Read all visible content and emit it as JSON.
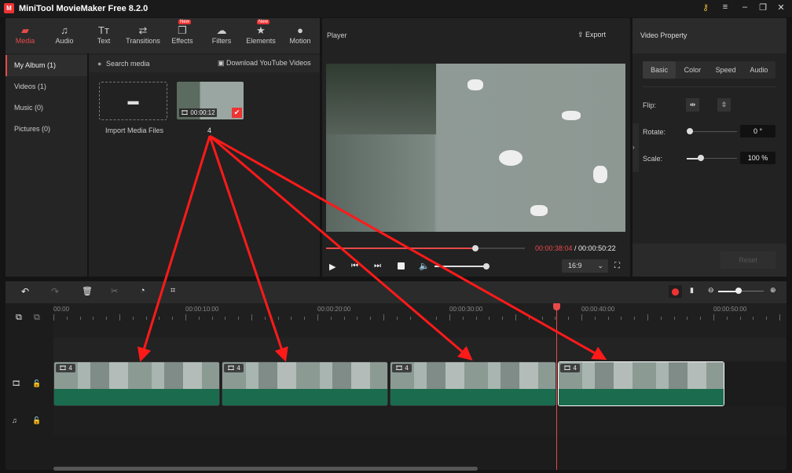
{
  "app": {
    "title": "MiniTool MovieMaker Free 8.2.0"
  },
  "toolbar": [
    {
      "label": "Media",
      "icon": "folder-icon",
      "active": true
    },
    {
      "label": "Audio",
      "icon": "music-icon"
    },
    {
      "label": "Text",
      "icon": "text-icon"
    },
    {
      "label": "Transitions",
      "icon": "transitions-icon"
    },
    {
      "label": "Effects",
      "icon": "effects-icon",
      "badge": "New"
    },
    {
      "label": "Filters",
      "icon": "filters-icon"
    },
    {
      "label": "Elements",
      "icon": "elements-icon",
      "badge": "New"
    },
    {
      "label": "Motion",
      "icon": "motion-icon"
    }
  ],
  "sidebar": {
    "items": [
      {
        "label": "My Album (1)"
      },
      {
        "label": "Videos (1)"
      },
      {
        "label": "Music (0)"
      },
      {
        "label": "Pictures (0)"
      }
    ]
  },
  "media": {
    "search_placeholder": "Search media",
    "download": "Download YouTube Videos",
    "import_label": "Import Media Files",
    "clip_duration": "00:00:12",
    "clip_count": "4"
  },
  "player": {
    "title": "Player",
    "export": "Export",
    "current_time": "00:00:38:04",
    "total_time": " / 00:00:50:22",
    "progress": 0.75,
    "volume": 0.8,
    "aspect": "16:9"
  },
  "property": {
    "title": "Video Property",
    "tabs": [
      "Basic",
      "Color",
      "Speed",
      "Audio"
    ],
    "flip_label": "Flip:",
    "rotate_label": "Rotate:",
    "rotate_value": "0 °",
    "scale_label": "Scale:",
    "scale_value": "100 %",
    "reset": "Reset"
  },
  "timeline": {
    "ruler": [
      "00:00",
      "00:00:10:00",
      "00:00:20:00",
      "00:00:30:00",
      "00:00:40:00",
      "00:00:50:00"
    ],
    "playhead_seconds": 38.1,
    "clips": [
      {
        "count": "4"
      },
      {
        "count": "4"
      },
      {
        "count": "4"
      },
      {
        "count": "4"
      }
    ]
  },
  "colors": {
    "accent": "#e84a4a",
    "audio_track": "#1b6b4f",
    "arrow": "#ff1a1a"
  }
}
